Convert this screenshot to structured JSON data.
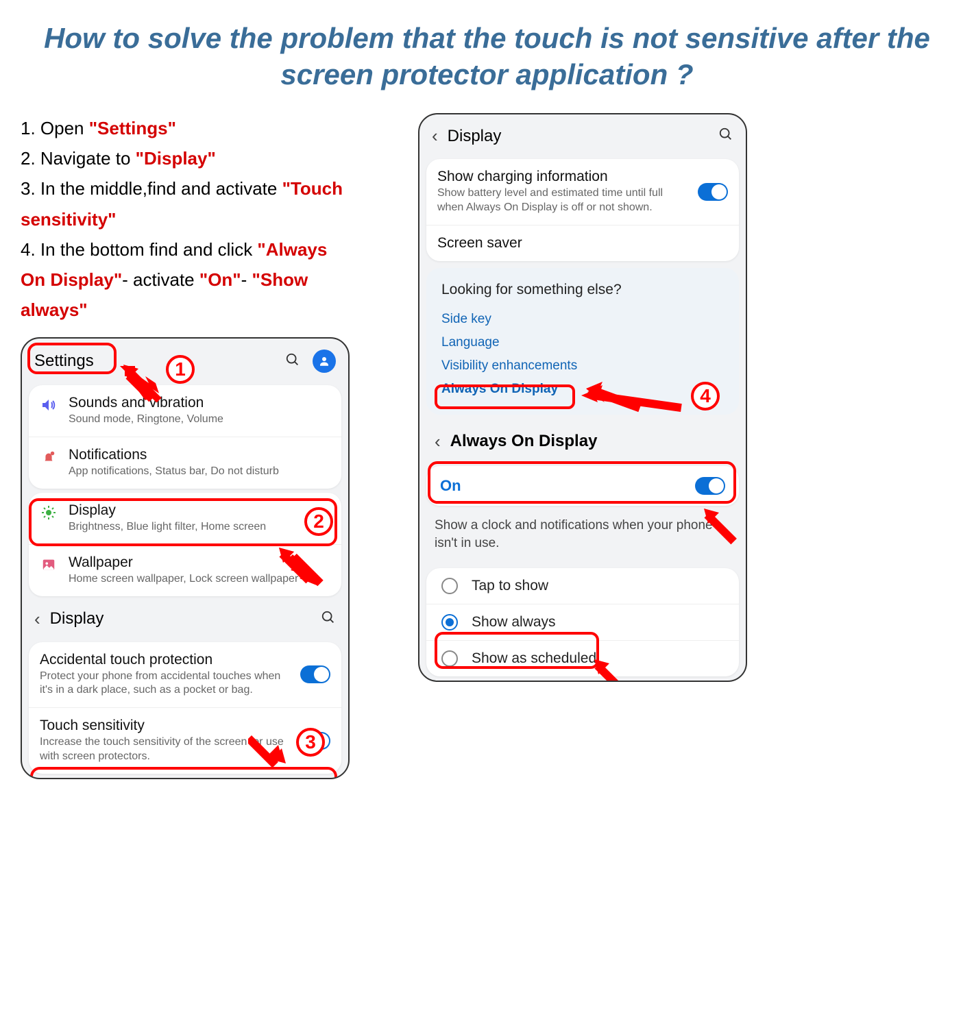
{
  "title": "How to solve the problem that the touch is not sensitive after  the screen protector application ?",
  "steps": {
    "s1a": "1. Open ",
    "s1b": "\"Settings\"",
    "s2a": "2. Navigate to ",
    "s2b": "\"Display\"",
    "s3a": "3. In the middle,find and activate ",
    "s3b": "\"Touch sensitivity\"",
    "s4a": "4. In the bottom find and click ",
    "s4b": "\"Always On Display\"",
    "s4c": "- activate ",
    "s4d": "\"On\"",
    "s4e": "- ",
    "s4f": "\"Show always\""
  },
  "phone1": {
    "header": "Settings",
    "items": [
      {
        "title": "Sounds and vibration",
        "sub": "Sound mode, Ringtone, Volume"
      },
      {
        "title": "Notifications",
        "sub": "App notifications, Status bar, Do not disturb"
      },
      {
        "title": "Display",
        "sub": "Brightness, Blue light filter, Home screen"
      },
      {
        "title": "Wallpaper",
        "sub": "Home screen wallpaper, Lock screen wallpaper"
      }
    ],
    "sub": "Display",
    "items2": [
      {
        "title": "Accidental touch protection",
        "sub": "Protect your phone from accidental touches when it's in a dark place, such as a pocket or bag."
      },
      {
        "title": "Touch sensitivity",
        "sub": "Increase the touch sensitivity of the screen for use with screen protectors."
      }
    ]
  },
  "phone2": {
    "header": "Display",
    "item1": {
      "title": "Show charging information",
      "sub": "Show battery level and estimated time until full when Always On Display is off or not shown."
    },
    "item2": {
      "title": "Screen saver"
    },
    "alt": {
      "title": "Looking for something else?",
      "links": [
        "Side key",
        "Language",
        "Visibility enhancements",
        "Always On Display"
      ]
    },
    "aodHeader": "Always On Display",
    "onLabel": "On",
    "desc": "Show a clock and notifications when your phone isn't in use.",
    "radios": [
      "Tap to show",
      "Show always",
      "Show as scheduled"
    ]
  },
  "labels": {
    "n1": "1",
    "n2": "2",
    "n3": "3",
    "n4": "4"
  }
}
